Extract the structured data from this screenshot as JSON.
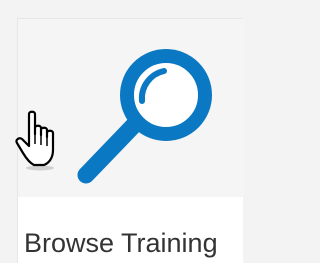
{
  "tile": {
    "label": "Browse Training",
    "icon": "magnifying-glass-icon",
    "icon_color": "#0a78c2"
  },
  "cursor": {
    "icon": "hand-pointer-cursor-icon"
  }
}
